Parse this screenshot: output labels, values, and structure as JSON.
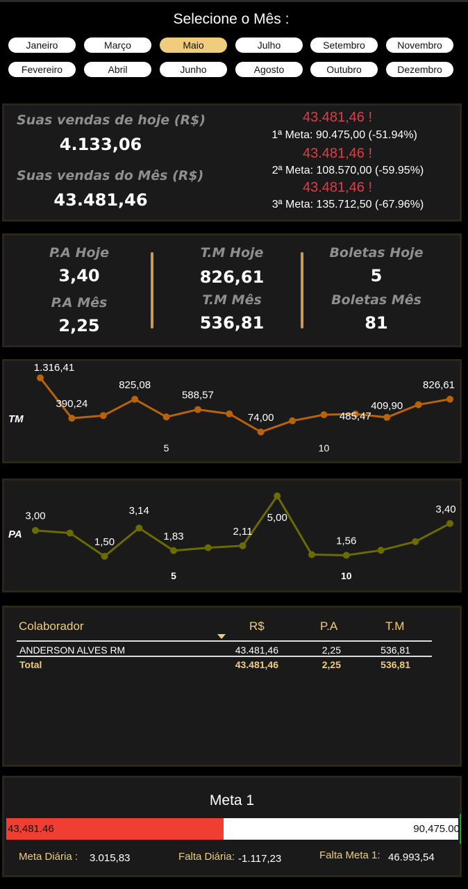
{
  "month_selector": {
    "title": "Selecione o Mês :",
    "selected": "Maio",
    "months_row1": [
      "Janeiro",
      "Março",
      "Maio",
      "Julho",
      "Setembro",
      "Novembro"
    ],
    "months_row2": [
      "Fevereiro",
      "Abril",
      "Junho",
      "Agosto",
      "Outubro",
      "Dezembro"
    ]
  },
  "sales": {
    "today_label": "Suas vendas de hoje (R$)",
    "today_value": "4.133,06",
    "month_label": "Suas vendas do Mês (R$)",
    "month_value": "43.481,46",
    "goals": [
      {
        "value": "43.481,46 !",
        "line": "1ª Meta: 90.475,00 (-51.94%)"
      },
      {
        "value": "43.481,46 !",
        "line": "2ª Meta: 108.570,00 (-59.95%)"
      },
      {
        "value": "43.481,46 !",
        "line": "3ª Meta: 135.712,50 (-67.96%)"
      }
    ]
  },
  "stats": {
    "pa_today_label": "P.A Hoje",
    "pa_today": "3,40",
    "pa_month_label": "P.A Mês",
    "pa_month": "2,25",
    "tm_today_label": "T.M Hoje",
    "tm_today": "826,61",
    "tm_month_label": "T.M Mês",
    "tm_month": "536,81",
    "bol_today_label": "Boletas Hoje",
    "bol_today": "5",
    "bol_month_label": "Boletas Mês",
    "bol_month": "81"
  },
  "chart_data": [
    {
      "type": "line",
      "ylabel": "TM",
      "color": "#b8630a",
      "x": [
        1,
        2,
        3,
        4,
        5,
        6,
        7,
        8,
        9,
        10,
        11,
        12,
        13,
        14
      ],
      "values": [
        1316.41,
        390.24,
        450,
        825.08,
        420,
        588.57,
        490,
        74.0,
        330,
        470,
        485.47,
        409.9,
        700,
        826.61
      ],
      "point_labels": [
        "1.316,41",
        "390,24",
        "",
        "825,08",
        "",
        "588,57",
        "",
        "74,00",
        "",
        "",
        "485,47",
        "409,90",
        "",
        "826,61"
      ],
      "x_ticks": [
        "5",
        "10"
      ]
    },
    {
      "type": "line",
      "ylabel": "PA",
      "color": "#6b6b00",
      "x": [
        1,
        2,
        3,
        4,
        5,
        6,
        7,
        8,
        9,
        10,
        11,
        12,
        13,
        14
      ],
      "values": [
        3.0,
        2.85,
        1.5,
        3.14,
        1.83,
        2.0,
        2.11,
        5.0,
        1.6,
        1.56,
        1.85,
        2.35,
        3.4
      ],
      "point_labels": [
        "3,00",
        "",
        "1,50",
        "3,14",
        "1,83",
        "",
        "2,11",
        "5,00",
        "",
        "1,56",
        "",
        "",
        "3,40"
      ],
      "x_ticks": [
        "5",
        "10"
      ]
    }
  ],
  "table": {
    "headers": [
      "Colaborador",
      "R$",
      "P.A",
      "T.M"
    ],
    "rows": [
      [
        "ANDERSON ALVES RM",
        "43.481,46",
        "2,25",
        "536,81"
      ]
    ],
    "total": [
      "Total",
      "43.481,46",
      "2,25",
      "536,81"
    ]
  },
  "meta": {
    "title": "Meta 1",
    "current": "43,481.46",
    "target": "90,475.00",
    "progress": 0.4806,
    "fill_color": "#f03f32",
    "daily_label": "Meta Diária :",
    "daily_value": "3.015,83",
    "missing_daily_label": "Falta Diária:",
    "missing_daily_value": "-1.117,23",
    "missing_label": "Falta Meta 1:",
    "missing_value": "46.993,54"
  }
}
